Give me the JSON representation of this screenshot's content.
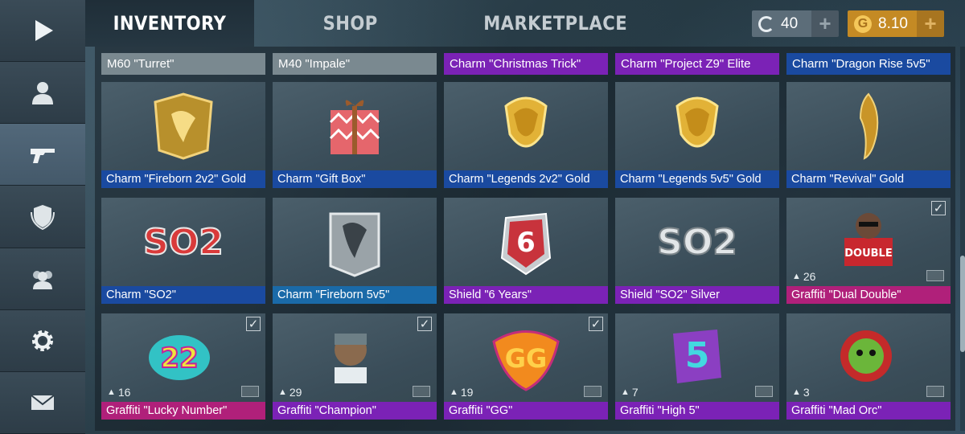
{
  "tabs": [
    {
      "label": "INVENTORY",
      "active": true
    },
    {
      "label": "SHOP",
      "active": false
    },
    {
      "label": "MARKETPLACE",
      "active": false
    }
  ],
  "currency": {
    "silver": {
      "icon": "C",
      "amount": "40",
      "plus": "+"
    },
    "gold": {
      "icon": "G",
      "amount": "8.10",
      "plus": "+"
    }
  },
  "sidebar": [
    {
      "icon": "play-icon",
      "active": false
    },
    {
      "icon": "profile-icon",
      "active": false
    },
    {
      "icon": "gun-icon",
      "active": true
    },
    {
      "icon": "clan-shield-icon",
      "active": false
    },
    {
      "icon": "friends-icon",
      "active": false
    },
    {
      "icon": "settings-gear-icon",
      "active": false
    },
    {
      "icon": "mail-icon",
      "active": false
    }
  ],
  "top_row": [
    {
      "label": "M60 \"Turret\"",
      "color": "#7a8990"
    },
    {
      "label": "M40 \"Impale\"",
      "color": "#7a8990"
    },
    {
      "label": "Charm \"Christmas Trick\"",
      "color": "#7b22b6"
    },
    {
      "label": "Charm \"Project Z9\" Elite",
      "color": "#7b22b6"
    },
    {
      "label": "Charm \"Dragon Rise 5v5\"",
      "color": "#1a4aa0"
    }
  ],
  "items": [
    {
      "name": "Charm \"Fireborn 2v2\" Gold",
      "color": "#1a4aa0",
      "art": "gold-banner",
      "count": "",
      "checked": false
    },
    {
      "name": "Charm \"Gift Box\"",
      "color": "#1a4aa0",
      "art": "gift-box",
      "count": "",
      "checked": false
    },
    {
      "name": "Charm \"Legends 2v2\" Gold",
      "color": "#1a4aa0",
      "art": "gold-crest",
      "count": "",
      "checked": false
    },
    {
      "name": "Charm \"Legends 5v5\" Gold",
      "color": "#1a4aa0",
      "art": "gold-crest",
      "count": "",
      "checked": false
    },
    {
      "name": "Charm \"Revival\" Gold",
      "color": "#1a4aa0",
      "art": "gold-feather",
      "count": "",
      "checked": false
    },
    {
      "name": "Charm \"SO2\"",
      "color": "#1a4aa0",
      "art": "so2-red",
      "count": "",
      "checked": false
    },
    {
      "name": "Charm \"Fireborn 5v5\"",
      "color": "#1a6aa8",
      "art": "silver-banner",
      "count": "",
      "checked": false
    },
    {
      "name": "Shield \"6 Years\"",
      "color": "#7b22b6",
      "art": "six-shield",
      "count": "",
      "checked": false
    },
    {
      "name": "Shield \"SO2\" Silver",
      "color": "#7b22b6",
      "art": "so2-silver",
      "count": "",
      "checked": false
    },
    {
      "name": "Graffiti \"Dual Double\"",
      "color": "#b0207a",
      "art": "graffiti-double",
      "count": "26",
      "checked": true
    },
    {
      "name": "Graffiti \"Lucky Number\"",
      "color": "#b0207a",
      "art": "graffiti-lucky",
      "count": "16",
      "checked": true
    },
    {
      "name": "Graffiti \"Champion\"",
      "color": "#7b22b6",
      "art": "graffiti-champion",
      "count": "29",
      "checked": true
    },
    {
      "name": "Graffiti \"GG\"",
      "color": "#7b22b6",
      "art": "graffiti-gg",
      "count": "19",
      "checked": true
    },
    {
      "name": "Graffiti \"High 5\"",
      "color": "#7b22b6",
      "art": "graffiti-high5",
      "count": "7",
      "checked": false
    },
    {
      "name": "Graffiti \"Mad Orc\"",
      "color": "#7b22b6",
      "art": "graffiti-orc",
      "count": "3",
      "checked": false
    }
  ]
}
